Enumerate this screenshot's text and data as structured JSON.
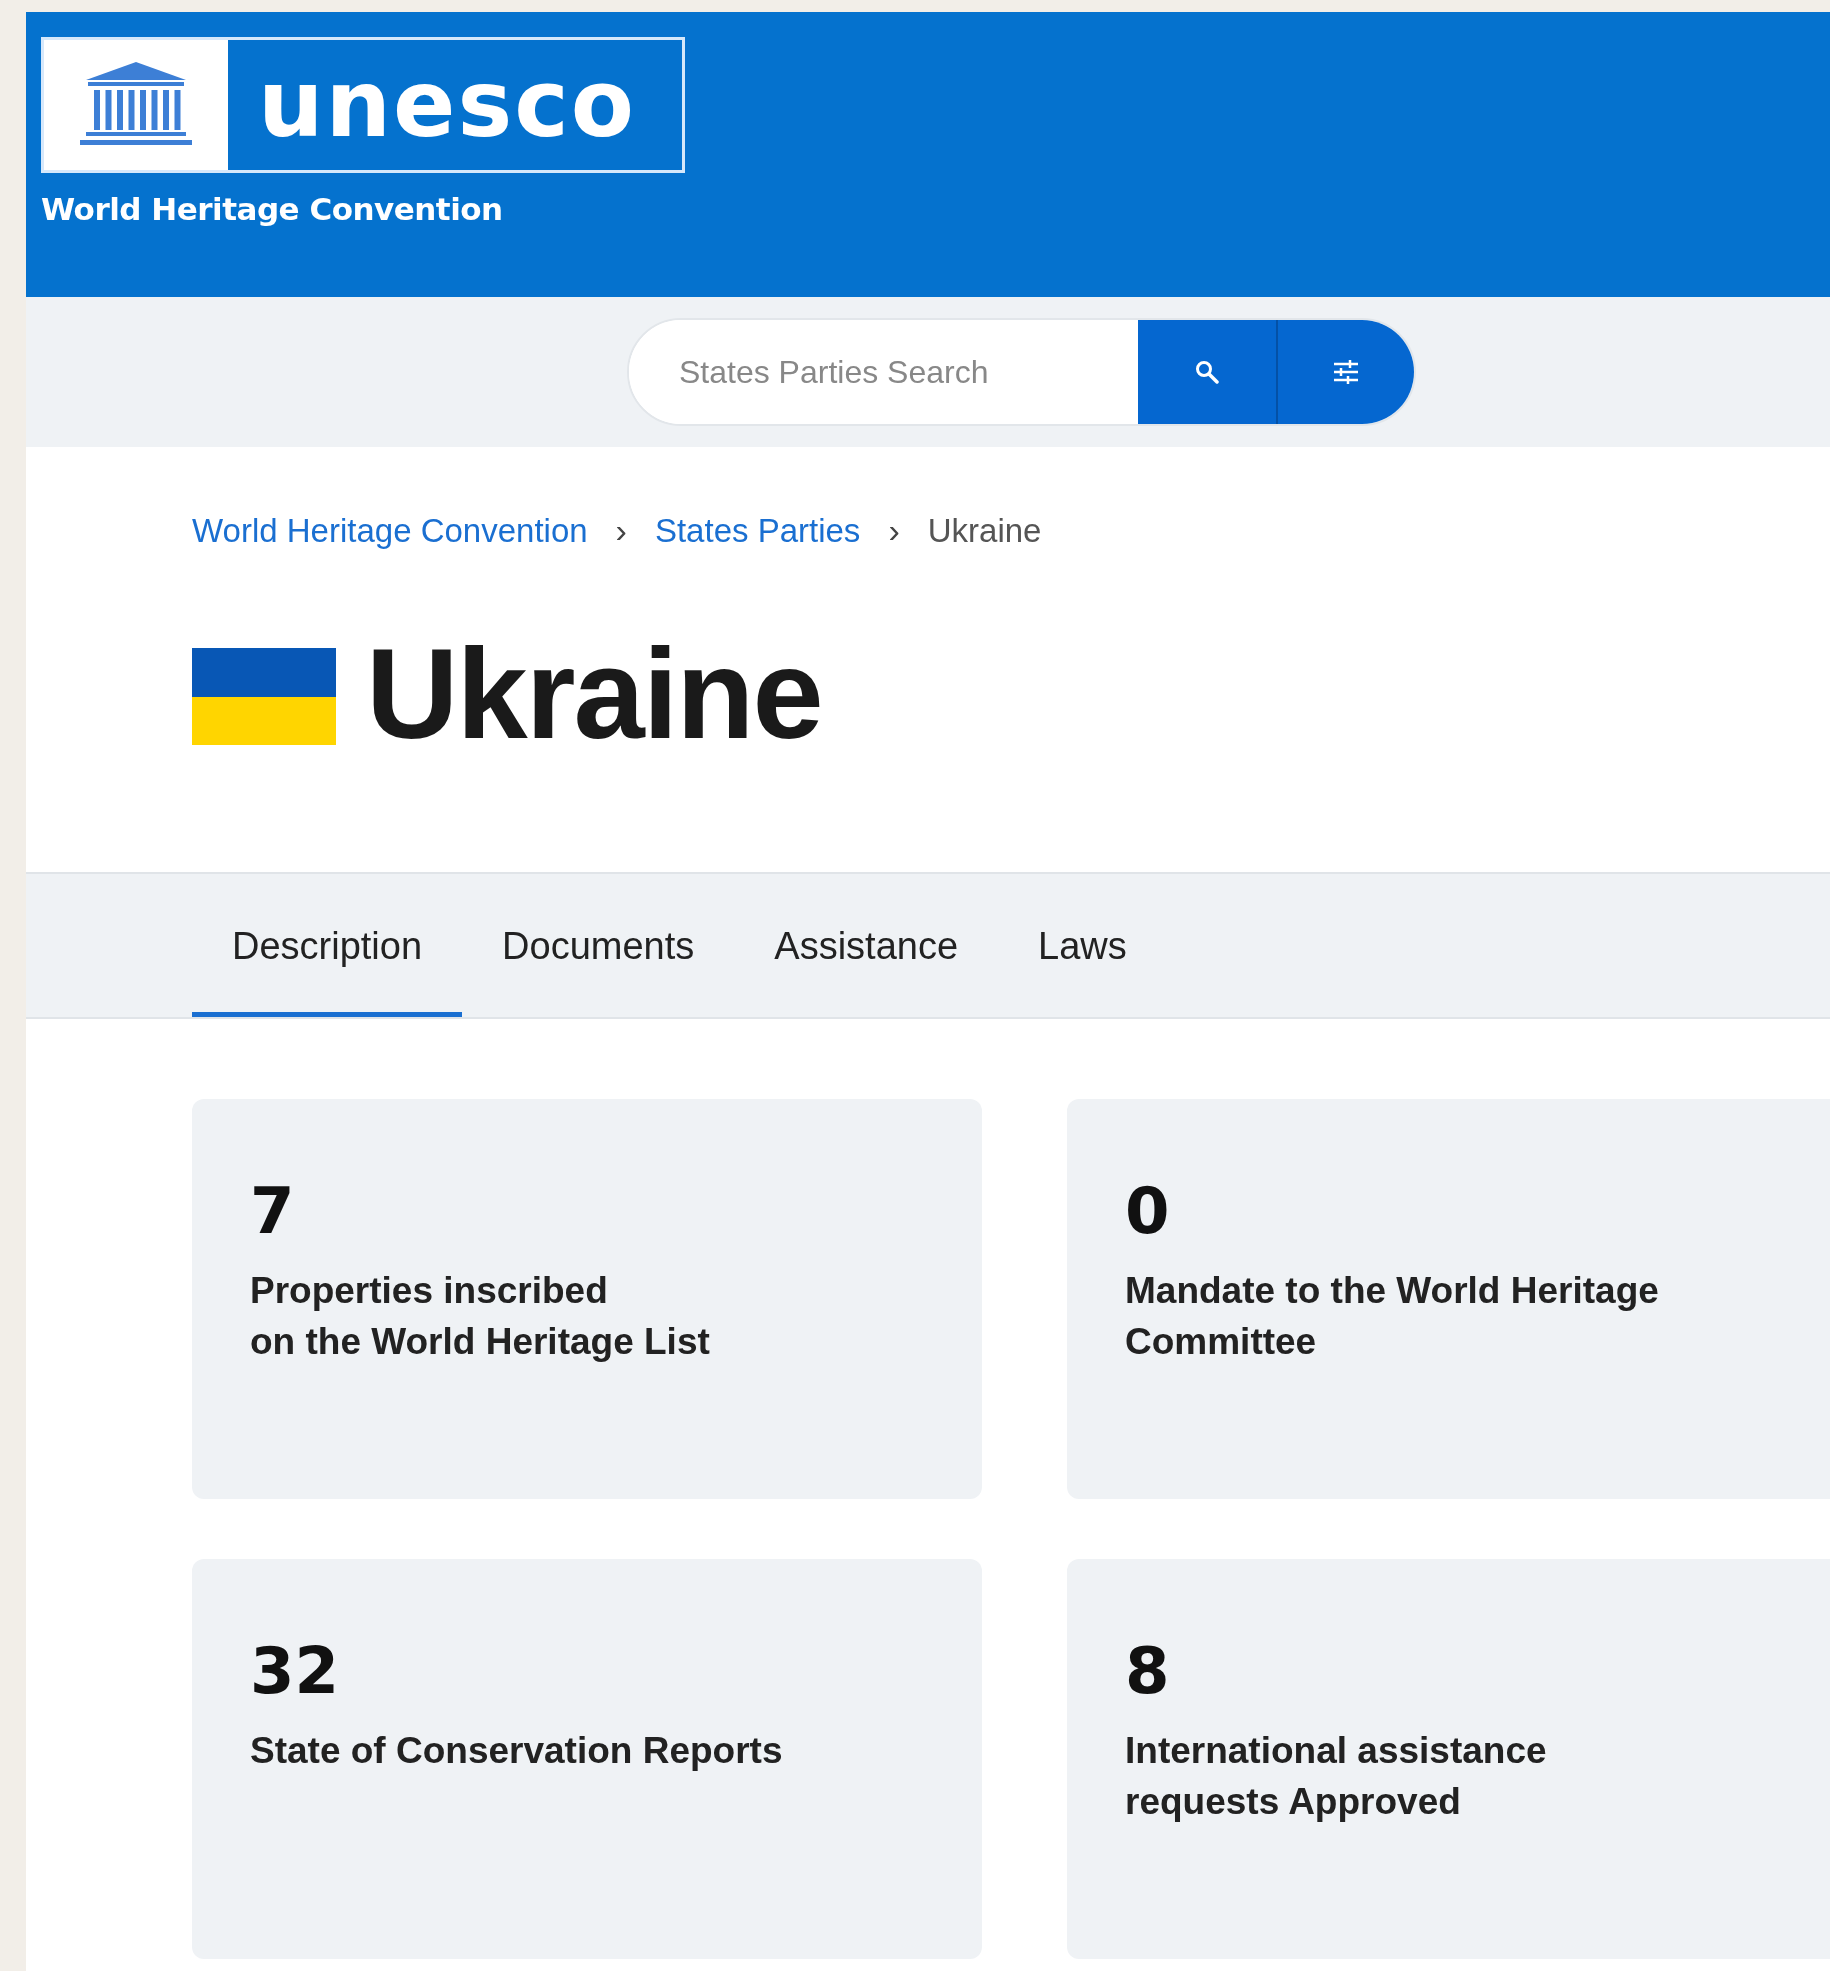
{
  "header": {
    "logo_text": "unesco",
    "subtitle": "World Heritage Convention"
  },
  "search": {
    "placeholder": "States Parties Search"
  },
  "breadcrumb": [
    {
      "label": "World Heritage Convention",
      "link": true
    },
    {
      "label": "States Parties",
      "link": true
    },
    {
      "label": "Ukraine",
      "link": false
    }
  ],
  "breadcrumb_separator": "›",
  "title": "Ukraine",
  "tabs": [
    {
      "label": "Description",
      "selected": true
    },
    {
      "label": "Documents",
      "selected": false
    },
    {
      "label": "Assistance",
      "selected": false
    },
    {
      "label": "Laws",
      "selected": false
    }
  ],
  "stats": [
    {
      "value": "7",
      "label": "Properties inscribed\non the World Heritage List"
    },
    {
      "value": "0",
      "label": "Mandate to the World Heritage\nCommittee"
    },
    {
      "value": "32",
      "label": "State of Conservation Reports"
    },
    {
      "value": "8",
      "label": "International assistance\nrequests Approved"
    }
  ]
}
